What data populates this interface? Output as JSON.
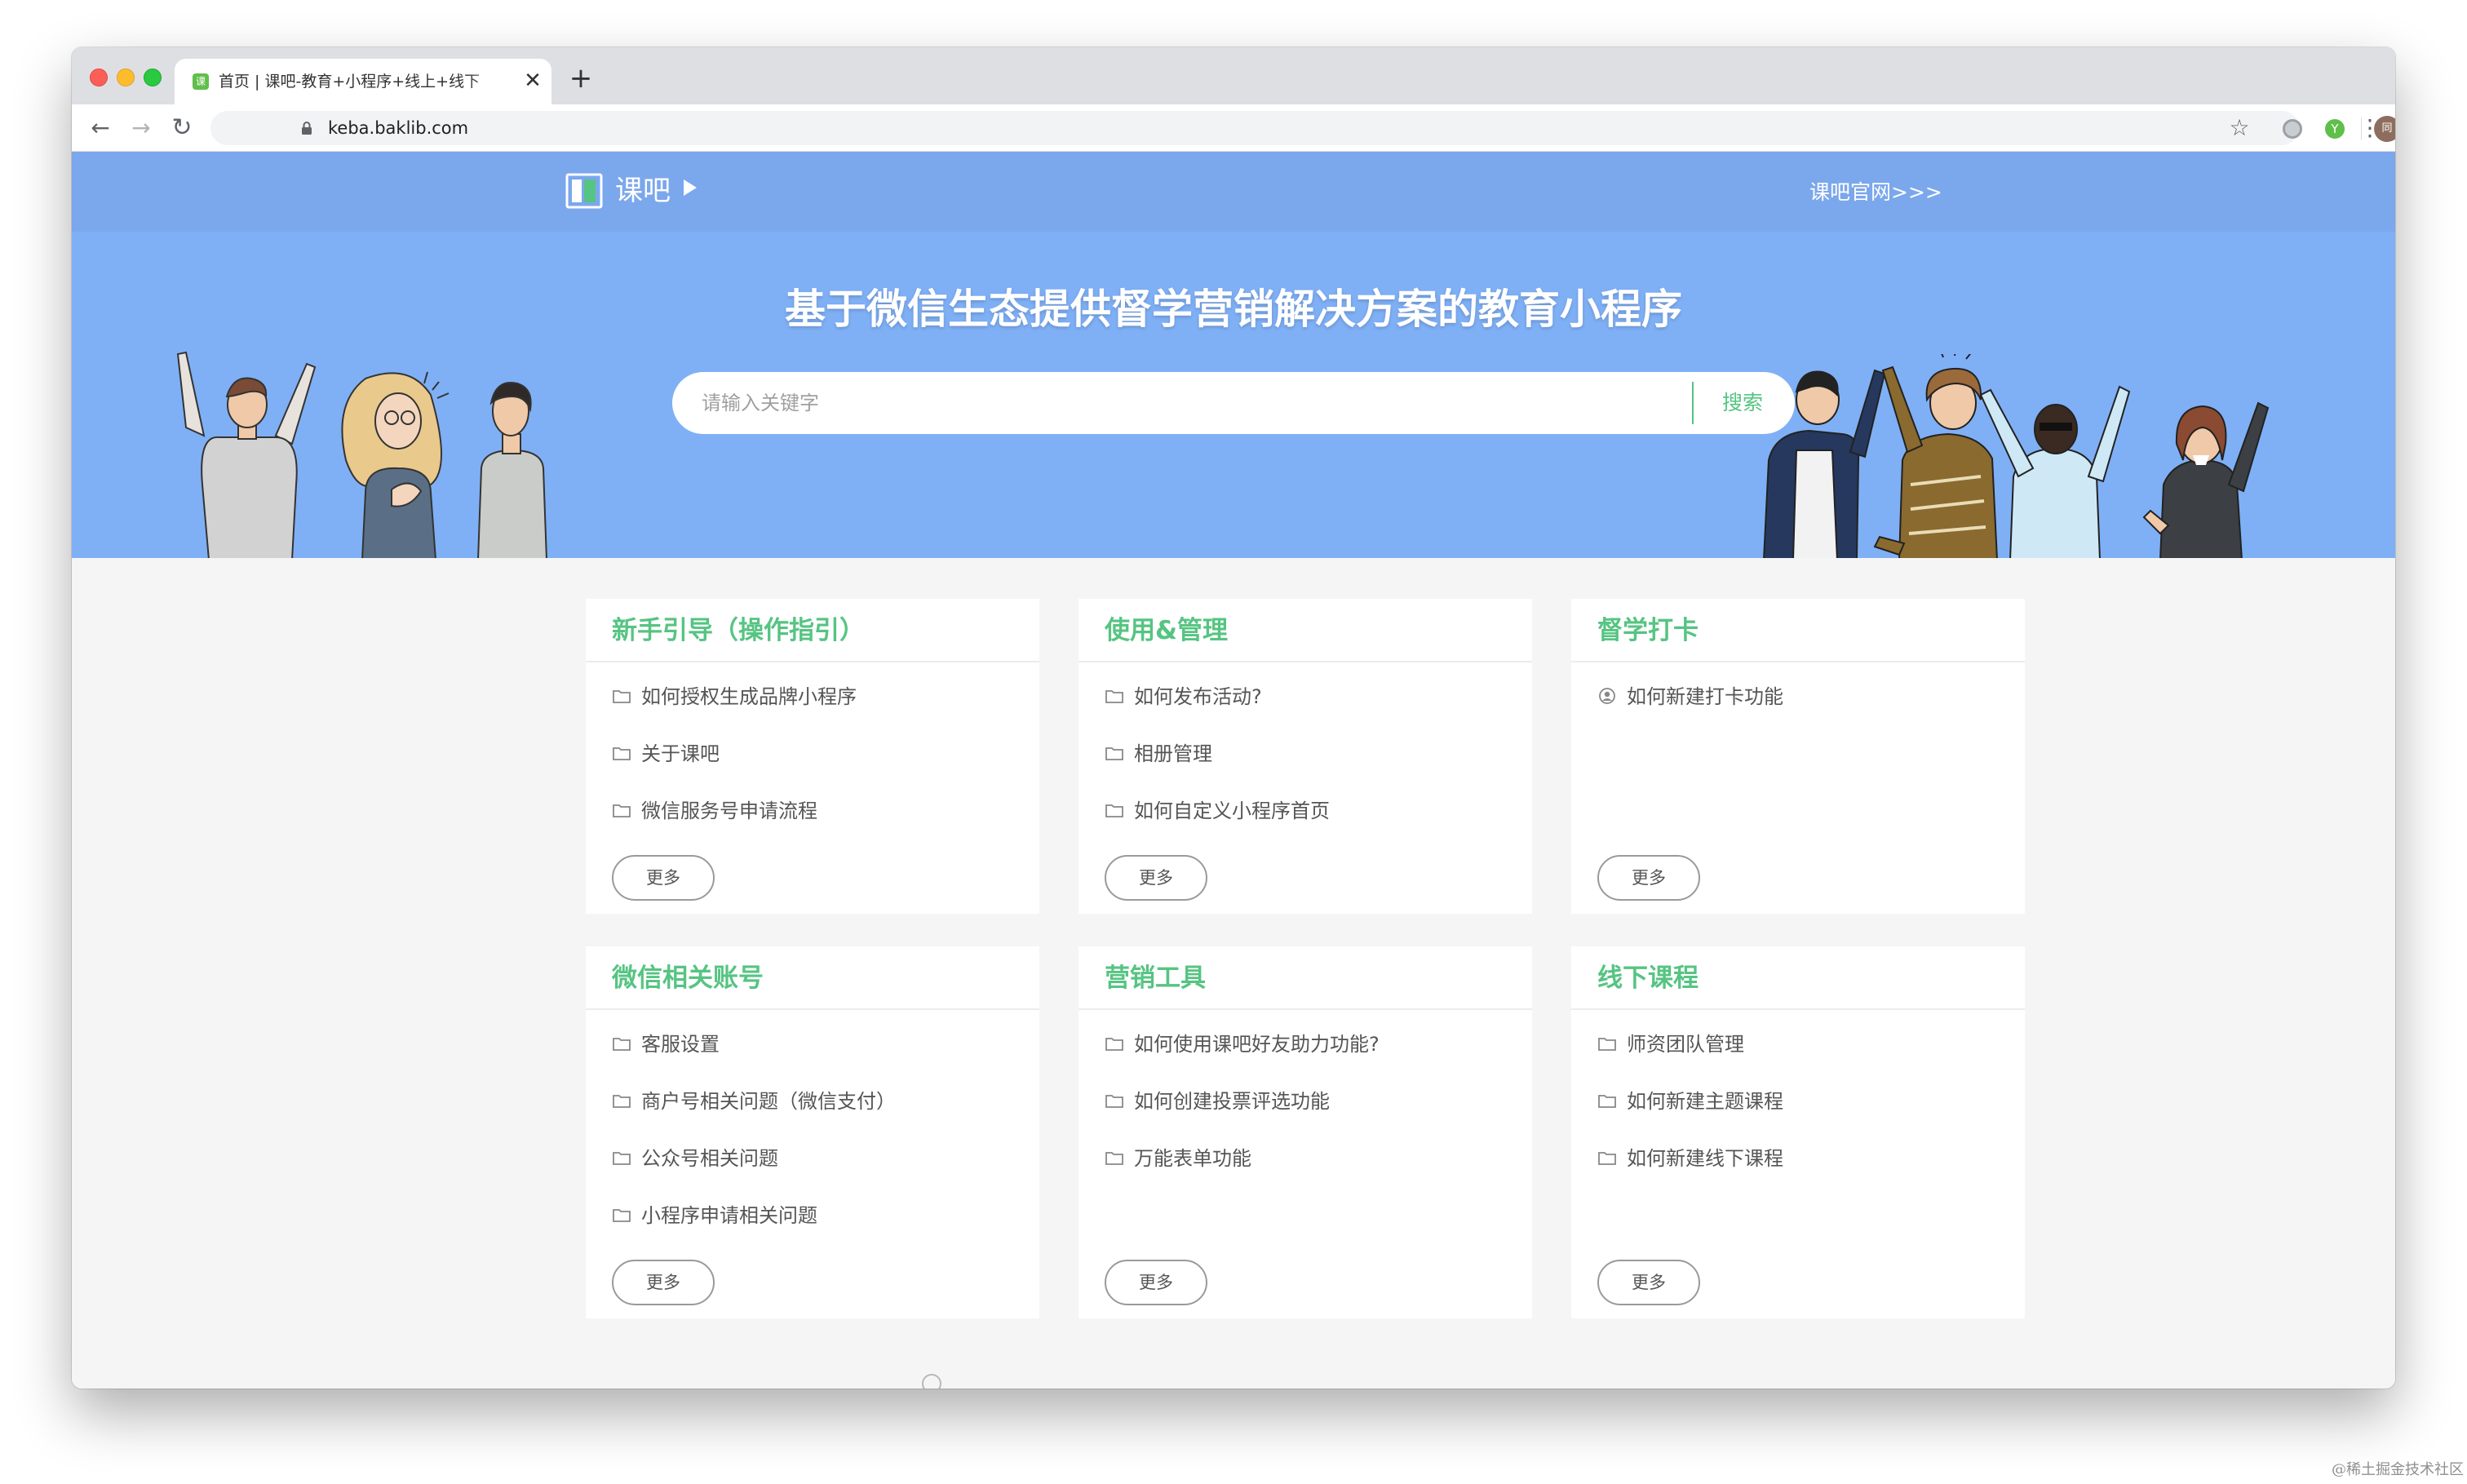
{
  "browser": {
    "tab_title": "首页 | 课吧-教育+小程序+线上+线下",
    "url": "keba.baklib.com",
    "tab_close_glyph": "✕",
    "new_tab_glyph": "+",
    "back_glyph": "←",
    "forward_glyph": "→",
    "reload_glyph": "↻",
    "bookmark_glyph": "☆",
    "extension_badge": "Y",
    "avatar_text": "同",
    "menu_glyph": "⋮"
  },
  "header": {
    "logo_text": "课吧",
    "official_link": "课吧官网>>>"
  },
  "hero": {
    "title": "基于微信生态提供督学营销解决方案的教育小程序",
    "search_placeholder": "请输入关键字",
    "search_button": "搜索"
  },
  "cards": [
    {
      "title": "新手引导（操作指引）",
      "items": [
        "如何授权生成品牌小程序",
        "关于课吧",
        "微信服务号申请流程"
      ],
      "more": "更多"
    },
    {
      "title": "使用&管理",
      "items": [
        "如何发布活动?",
        "相册管理",
        "如何自定义小程序首页"
      ],
      "more": "更多"
    },
    {
      "title": "督学打卡",
      "items": [
        "如何新建打卡功能"
      ],
      "more": "更多"
    },
    {
      "title": "微信相关账号",
      "items": [
        "客服设置",
        "商户号相关问题（微信支付）",
        "公众号相关问题",
        "小程序申请相关问题"
      ],
      "more": "更多"
    },
    {
      "title": "营销工具",
      "items": [
        "如何使用课吧好友助力功能?",
        "如何创建投票评选功能",
        "万能表单功能"
      ],
      "more": "更多"
    },
    {
      "title": "线下课程",
      "items": [
        "师资团队管理",
        "如何新建主题课程",
        "如何新建线下课程"
      ],
      "more": "更多"
    }
  ],
  "watermark": "@稀土掘金技术社区",
  "colors": {
    "accent_green": "#56c482",
    "header_blue": "#7ba7ec",
    "hero_blue": "#7fb0f6"
  }
}
